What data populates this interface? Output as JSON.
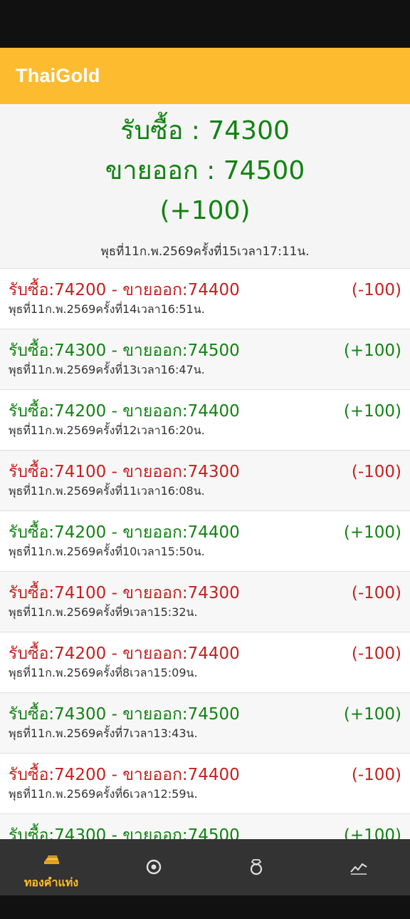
{
  "app": {
    "title": "ThaiGold"
  },
  "colors": {
    "accent": "#FDBB2F",
    "up": "#128212",
    "down": "#C62020",
    "nav_bg": "#333333"
  },
  "hero": {
    "buy": "รับซื้อ : 74300",
    "sell": "ขายออก : 74500",
    "change": "(+100)",
    "trend": "up",
    "time": "พุธที่11ก.พ.2569ครั้งที่15เวลา17:11น."
  },
  "history": [
    {
      "price": "รับซื้อ:74200 - ขายออก:74400",
      "change": "(-100)",
      "time": "พุธที่11ก.พ.2569ครั้งที่14เวลา16:51น.",
      "trend": "down"
    },
    {
      "price": "รับซื้อ:74300 - ขายออก:74500",
      "change": "(+100)",
      "time": "พุธที่11ก.พ.2569ครั้งที่13เวลา16:47น.",
      "trend": "up"
    },
    {
      "price": "รับซื้อ:74200 - ขายออก:74400",
      "change": "(+100)",
      "time": "พุธที่11ก.พ.2569ครั้งที่12เวลา16:20น.",
      "trend": "up"
    },
    {
      "price": "รับซื้อ:74100 - ขายออก:74300",
      "change": "(-100)",
      "time": "พุธที่11ก.พ.2569ครั้งที่11เวลา16:08น.",
      "trend": "down"
    },
    {
      "price": "รับซื้อ:74200 - ขายออก:74400",
      "change": "(+100)",
      "time": "พุธที่11ก.พ.2569ครั้งที่10เวลา15:50น.",
      "trend": "up"
    },
    {
      "price": "รับซื้อ:74100 - ขายออก:74300",
      "change": "(-100)",
      "time": "พุธที่11ก.พ.2569ครั้งที่9เวลา15:32น.",
      "trend": "down"
    },
    {
      "price": "รับซื้อ:74200 - ขายออก:74400",
      "change": "(-100)",
      "time": "พุธที่11ก.พ.2569ครั้งที่8เวลา15:09น.",
      "trend": "down"
    },
    {
      "price": "รับซื้อ:74300 - ขายออก:74500",
      "change": "(+100)",
      "time": "พุธที่11ก.พ.2569ครั้งที่7เวลา13:43น.",
      "trend": "up"
    },
    {
      "price": "รับซื้อ:74200 - ขายออก:74400",
      "change": "(-100)",
      "time": "พุธที่11ก.พ.2569ครั้งที่6เวลา12:59น.",
      "trend": "down"
    },
    {
      "price": "รับซื้อ:74300 - ขายออก:74500",
      "change": "(+100)",
      "time": "",
      "trend": "up"
    }
  ],
  "nav": [
    {
      "label": "ทองคำแท่ง",
      "icon": "gold-bar-icon",
      "active": true
    },
    {
      "label": "",
      "icon": "circle-dot-icon",
      "active": false
    },
    {
      "label": "",
      "icon": "ring-icon",
      "active": false
    },
    {
      "label": "",
      "icon": "trend-chart-icon",
      "active": false
    }
  ]
}
